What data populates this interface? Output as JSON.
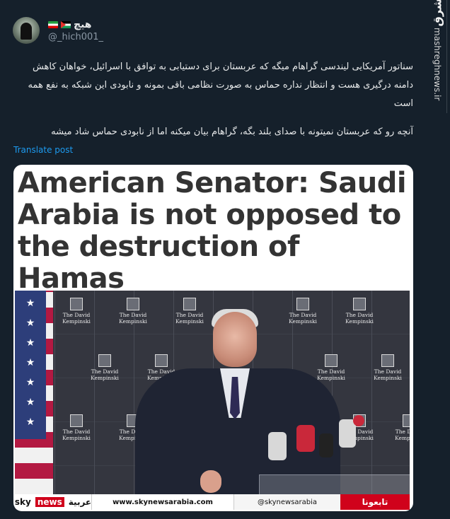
{
  "watermark": {
    "logo_text": "مشرق",
    "site_text": "mashreghnews.ir"
  },
  "author": {
    "display_name": "هیچ",
    "handle": "@_hich001_"
  },
  "tweet": {
    "paragraph_1": "سناتور آمریکایی لیندسی گراهام میگه که عربستان برای دستیابی به توافق با اسرائیل، خواهان کاهش دامنه درگیری هست و انتظار نداره حماس به صورت نظامی باقی بمونه و نابودی این شبکه به نفع همه است",
    "paragraph_2": "آنچه رو که عربستان نمیتونه با صدای بلند بگه، گراهام بیان میکنه اما از نابودی حماس شاد میشه",
    "translate_label": "Translate post"
  },
  "media": {
    "headline": "American Senator: Saudi Arabia is not opposed to the destruction of Hamas",
    "backdrop_logo_text_1": "The David",
    "backdrop_logo_text_2": "Kempinski",
    "ticker": {
      "brand_sky": "sky",
      "brand_news": "news",
      "brand_arabic": "عربية",
      "url": "www.skynewsarabia.com",
      "social_handle": "@skynewsarabia",
      "live_label": "تابعونا"
    }
  },
  "colors": {
    "background": "#15202b",
    "link": "#1d9bf0",
    "secondary_text": "#8b98a5",
    "ticker_red": "#d0021b"
  }
}
